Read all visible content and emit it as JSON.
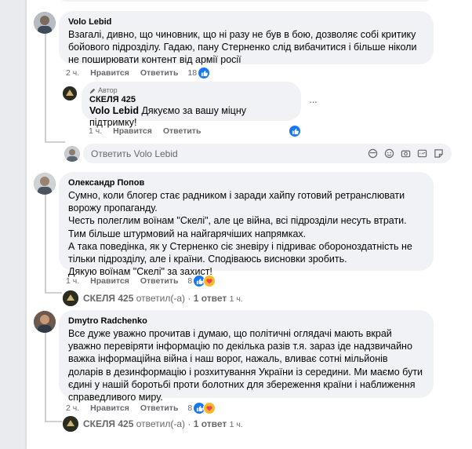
{
  "comments": [
    {
      "author": "Volo Lebid",
      "text": "Взагалі, дивно, що чиновник, що ні разу не був в бою, дозволяє собі критику бойового підрозділу. Гадаю, пану Стерненко слід вибачитися і більше ніколи не поширювати контент від армії росії",
      "time": "2 ч.",
      "like_label": "Нравится",
      "reply_label": "Ответить",
      "reactions": "18",
      "reply": {
        "badge": "Автор",
        "author": "СКЕЛЯ 425",
        "mention": "Volo Lebid",
        "text": " Дякуємо за вашу міцну підтримку!",
        "time": "1 ч.",
        "like_label": "Нравится",
        "reply_label": "Ответить",
        "more": "···"
      },
      "reply_input_placeholder": "Ответить Volo Lebid"
    },
    {
      "author": "Олександр Попов",
      "text": "Сумно, коли блогер стає радником і заради хайпу готовий ретранслювати ворожу пропаганду.\nЧесть полеглим воїнам \"Скелі\", але це війна, всі підрозділи несуть втрати. Тим більше штурмовий на найгарячіших напрямках.\nА така поведінка, як у Стерненко сіє зневіру і підриває обороноздатність не тільки підрозділу, але і країни. Сподіваюсь висновки зробить.\nДякую воїнам \"Скелі\" за захист!",
      "time": "1 ч.",
      "like_label": "Нравится",
      "reply_label": "Ответить",
      "reactions": "8",
      "replies_summary": {
        "author": "СКЕЛЯ 425",
        "action": " ответил(-а) · ",
        "count": "1 ответ",
        "time": "1 ч."
      }
    },
    {
      "author": "Dmytro Radchenko",
      "text": "Все дуже уважно прочитав і думаю, що політичні оглядачі мають вкрай уважно перевіряти інформацію по декілька разів т.я. зараз іде надзвичайно важка інформаційна війна і наш ворог, нажаль, вливає сотні мільйонів доларів в дезинформацію і розхитування України із середини. Ми маємо бути єдині у нашій боротьбі проти болотних для збереження країни і наближення справедливого миру.",
      "time": "2 ч.",
      "like_label": "Нравится",
      "reply_label": "Ответить",
      "reactions": "8",
      "replies_summary": {
        "author": "СКЕЛЯ 425",
        "action": " ответил(-а) · ",
        "count": "1 ответ",
        "time": "1 ч."
      }
    }
  ],
  "colors": {
    "like_blue": "#1877f2",
    "bubble_bg": "#f0f2f5",
    "meta_gray": "#65676b"
  }
}
